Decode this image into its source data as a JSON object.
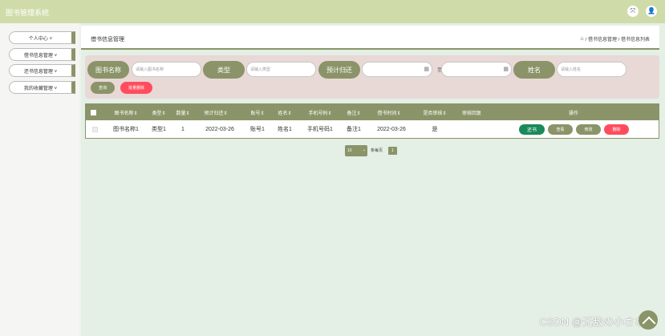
{
  "app": {
    "title": "图书管理系统"
  },
  "colors": {
    "accent": "#8b9468",
    "topbar": "#cfdca9",
    "danger": "#ff4d5e",
    "success": "#1a8a5a"
  },
  "header": {
    "icons": [
      "fullscreen-icon",
      "user-icon"
    ]
  },
  "sidebar": {
    "items": [
      {
        "label": "个人中心 ˅"
      },
      {
        "label": "借书信息管理 ˅"
      },
      {
        "label": "还书信息管理 ˅"
      },
      {
        "label": "我的收藏管理 ˅"
      }
    ]
  },
  "breadcrumb": {
    "page_title": "借书信息管理",
    "crumbs": "/ 借书信息管理 / 借书信息列表"
  },
  "search": {
    "book_name_label": "图书名称",
    "book_name_placeholder": "请输入图书名称",
    "type_label": "类型",
    "type_placeholder": "请输入类型",
    "return_label": "预计归还",
    "date_sep": "至",
    "name_label": "姓名",
    "name_placeholder": "请输入姓名",
    "query_button": "查询",
    "batch_delete_button": "批量删除"
  },
  "table": {
    "headers": [
      "图书名称⇕",
      "类型⇕",
      "数量⇕",
      "预计归还⇕",
      "账号⇕",
      "姓名⇕",
      "手机号码⇕",
      "备注⇕",
      "借书时间⇕",
      "是否审核⇕",
      "审核回复",
      "操作"
    ],
    "rows": [
      {
        "cells": [
          "图书名称1",
          "类型1",
          "1",
          "2022-03-26",
          "账号1",
          "姓名1",
          "手机号码1",
          "备注1",
          "2022-03-26",
          "是",
          ""
        ],
        "actions": [
          "还书",
          "查看",
          "修改",
          "删除"
        ]
      }
    ]
  },
  "pagination": {
    "page_size": "10",
    "per_page_label": "条每页",
    "current_page": "1"
  },
  "watermark": "CSDN @无敌の小さな鲛"
}
